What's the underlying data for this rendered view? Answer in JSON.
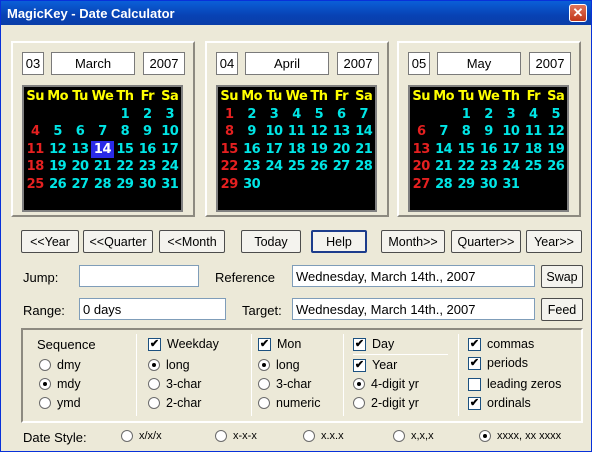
{
  "window": {
    "title": "MagicKey - Date Calculator",
    "close_glyph": "✕"
  },
  "calendars": [
    {
      "month_num": "03",
      "month_name": "March",
      "year": "2007",
      "dow": [
        "Su",
        "Mo",
        "Tu",
        "We",
        "Th",
        "Fr",
        "Sa"
      ],
      "weeks": [
        [
          "",
          "",
          "",
          "",
          "1",
          "2",
          "3"
        ],
        [
          "4",
          "5",
          "6",
          "7",
          "8",
          "9",
          "10"
        ],
        [
          "11",
          "12",
          "13",
          "14",
          "15",
          "16",
          "17"
        ],
        [
          "18",
          "19",
          "20",
          "21",
          "22",
          "23",
          "24"
        ],
        [
          "25",
          "26",
          "27",
          "28",
          "29",
          "30",
          "31"
        ],
        [
          "",
          "",
          "",
          "",
          "",
          "",
          ""
        ]
      ],
      "selected": "14"
    },
    {
      "month_num": "04",
      "month_name": "April",
      "year": "2007",
      "dow": [
        "Su",
        "Mo",
        "Tu",
        "We",
        "Th",
        "Fr",
        "Sa"
      ],
      "weeks": [
        [
          "1",
          "2",
          "3",
          "4",
          "5",
          "6",
          "7"
        ],
        [
          "8",
          "9",
          "10",
          "11",
          "12",
          "13",
          "14"
        ],
        [
          "15",
          "16",
          "17",
          "18",
          "19",
          "20",
          "21"
        ],
        [
          "22",
          "23",
          "24",
          "25",
          "26",
          "27",
          "28"
        ],
        [
          "29",
          "30",
          "",
          "",
          "",
          "",
          ""
        ],
        [
          "",
          "",
          "",
          "",
          "",
          "",
          ""
        ]
      ],
      "selected": ""
    },
    {
      "month_num": "05",
      "month_name": "May",
      "year": "2007",
      "dow": [
        "Su",
        "Mo",
        "Tu",
        "We",
        "Th",
        "Fr",
        "Sa"
      ],
      "weeks": [
        [
          "",
          "",
          "1",
          "2",
          "3",
          "4",
          "5"
        ],
        [
          "6",
          "7",
          "8",
          "9",
          "10",
          "11",
          "12"
        ],
        [
          "13",
          "14",
          "15",
          "16",
          "17",
          "18",
          "19"
        ],
        [
          "20",
          "21",
          "22",
          "23",
          "24",
          "25",
          "26"
        ],
        [
          "27",
          "28",
          "29",
          "30",
          "31",
          "",
          ""
        ],
        [
          "",
          "",
          "",
          "",
          "",
          "",
          ""
        ]
      ],
      "selected": ""
    }
  ],
  "nav": {
    "prev_year": "<<Year",
    "prev_quarter": "<<Quarter",
    "prev_month": "<<Month",
    "today": "Today",
    "help": "Help",
    "next_month": "Month>>",
    "next_quarter": "Quarter>>",
    "next_year": "Year>>"
  },
  "jump": {
    "label": "Jump:",
    "value": ""
  },
  "reference": {
    "label": "Reference",
    "value": "Wednesday, March 14th., 2007",
    "button": "Swap"
  },
  "range": {
    "label": "Range:",
    "value": "0 days"
  },
  "target": {
    "label": "Target:",
    "value": "Wednesday, March 14th., 2007",
    "button": "Feed"
  },
  "options": {
    "sequence": {
      "label": "Sequence",
      "items": [
        "dmy",
        "mdy",
        "ymd"
      ],
      "selected": "mdy"
    },
    "weekday": {
      "label": "Weekday",
      "checked": true,
      "items": [
        "long",
        "3-char",
        "2-char"
      ],
      "selected": "long"
    },
    "mon": {
      "label": "Mon",
      "checked": true,
      "items": [
        "long",
        "3-char",
        "numeric"
      ],
      "selected": "long"
    },
    "day": {
      "label": "Day",
      "checked": true
    },
    "year": {
      "label": "Year",
      "checked": true,
      "items": [
        "4-digit yr",
        "2-digit yr"
      ],
      "selected": "4-digit yr"
    },
    "extras": [
      {
        "label": "commas",
        "checked": true
      },
      {
        "label": "periods",
        "checked": true
      },
      {
        "label": "leading zeros",
        "checked": false
      },
      {
        "label": "ordinals",
        "checked": true
      }
    ]
  },
  "date_style": {
    "label": "Date Style:",
    "items": [
      "x/x/x",
      "x-x-x",
      "x.x.x",
      "x,x,x",
      "xxxx, xx xxxx"
    ],
    "selected": "xxxx, xx xxxx"
  },
  "colors": {
    "weekday_header": "#ffff00",
    "day": "#00e5e5",
    "sunday": "#e52020",
    "selected_day_bg": "#2a2ae8"
  }
}
